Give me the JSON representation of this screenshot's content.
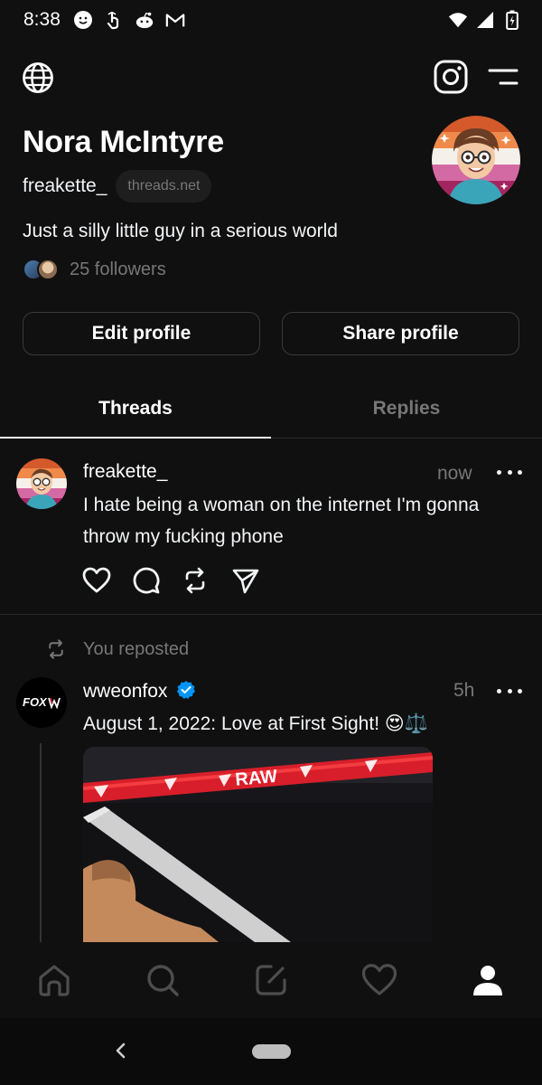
{
  "status_bar": {
    "time": "8:38",
    "left_icons": [
      "smiley-icon",
      "touch-icon",
      "reddit-icon",
      "gmail-icon"
    ],
    "right_icons": [
      "wifi-icon",
      "signal-icon",
      "battery-icon"
    ]
  },
  "header": {
    "left_icon": "globe-icon",
    "right_icons": [
      "instagram-icon",
      "menu-icon"
    ]
  },
  "profile": {
    "name": "Nora McIntyre",
    "handle": "freakette_",
    "domain_badge": "threads.net",
    "bio": "Just a silly little guy in a serious world",
    "followers_text": "25 followers"
  },
  "buttons": {
    "edit_label": "Edit profile",
    "share_label": "Share profile"
  },
  "tabs": [
    {
      "label": "Threads",
      "active": true
    },
    {
      "label": "Replies",
      "active": false
    }
  ],
  "posts": [
    {
      "username": "freakette_",
      "time": "now",
      "text": "I hate being a woman on the internet I'm gonna throw my fucking phone",
      "actions": [
        "heart-icon",
        "comment-icon",
        "repost-icon",
        "share-icon"
      ]
    },
    {
      "repost_label": "You reposted",
      "username": "wweonfox",
      "verified": true,
      "time": "5h",
      "text": "August 1, 2022: Love at First Sight! 😍⚖️",
      "avatar_text": "FOX",
      "media_overlay_text": "RAW"
    }
  ],
  "bottom_nav": [
    "home-icon",
    "search-icon",
    "compose-icon",
    "activity-heart-icon",
    "profile-icon"
  ],
  "colors": {
    "background": "#101010",
    "text": "#f3f5f7",
    "muted": "#777777",
    "verified": "#0095f6",
    "border": "#3a3a3a"
  }
}
